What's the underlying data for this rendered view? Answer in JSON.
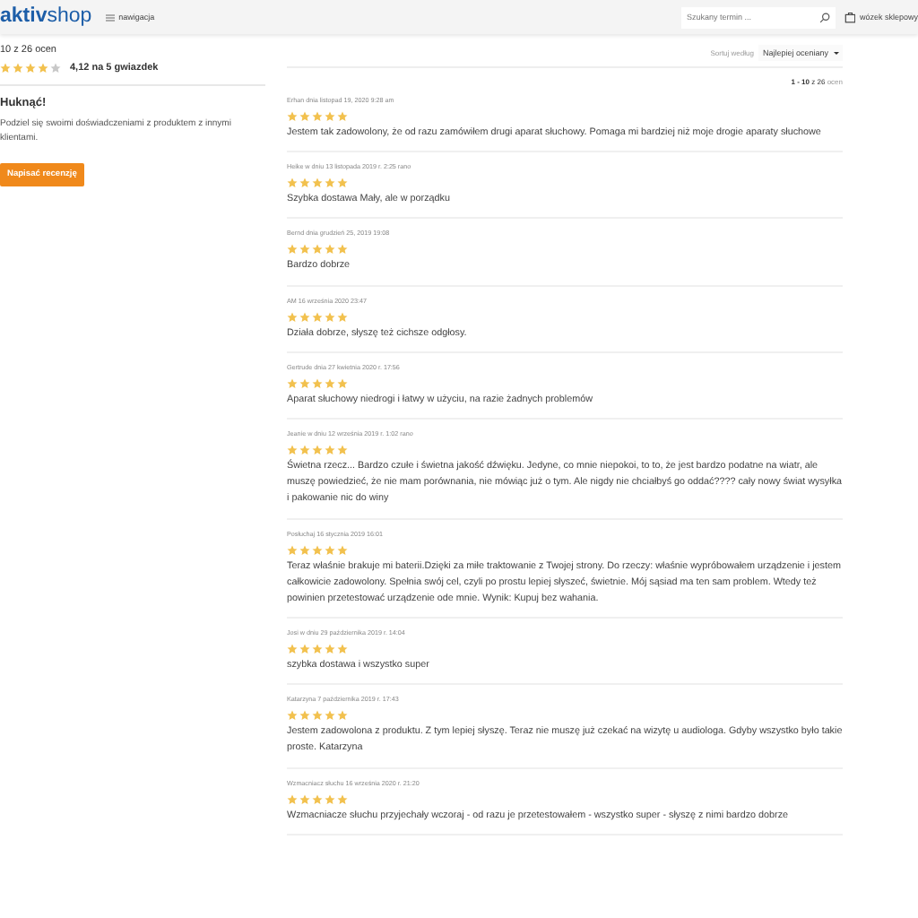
{
  "header": {
    "logo_brand": "aktiv",
    "logo_suffix": "shop",
    "nav_label": "nawigacja",
    "search": {
      "placeholder": "Szukany termin ..."
    },
    "cart_label": "wózek sklepowy"
  },
  "summary": {
    "count": "10 z 26 ocen",
    "stars": 4,
    "average": "4,12 na 5 gwiazdek"
  },
  "cta": {
    "title": "Huknąć!",
    "text": "Podziel się swoimi doświadczeniami z produktem z innymi klientami.",
    "button": "Napisać recenzję"
  },
  "sort": {
    "label": "Sortuj według",
    "value": "Najlepiej oceniany"
  },
  "pagination": {
    "range": "1 - 10",
    "of": "z 26",
    "unit": "ocen"
  },
  "reviews": [
    {
      "meta": "Erhan dnia listopad 19, 2020 9:28 am",
      "stars": 5,
      "text": "Jestem tak zadowolony, że od razu zamówiłem drugi aparat słuchowy. Pomaga mi bardziej niż moje drogie aparaty słuchowe"
    },
    {
      "meta": "Heike w dniu 13 listopada 2019 r. 2:25 rano",
      "stars": 5,
      "text": "Szybka dostawa Mały, ale w porządku"
    },
    {
      "meta": "Bernd dnia grudzień 25, 2019 19:08",
      "stars": 5,
      "text": "Bardzo dobrze"
    },
    {
      "meta": "AM 16 września 2020 23:47",
      "stars": 5,
      "text": "Działa dobrze, słyszę też cichsze odgłosy."
    },
    {
      "meta": "Gertrude dnia 27 kwietnia 2020 r. 17:56",
      "stars": 5,
      "text": "Aparat słuchowy niedrogi i łatwy w użyciu, na razie żadnych problemów"
    },
    {
      "meta": "Jeanie w dniu 12 września 2019 r. 1:02 rano",
      "stars": 5,
      "text": "Świetna rzecz... Bardzo czułe i świetna jakość dźwięku. Jedyne, co mnie niepokoi, to to, że jest bardzo podatne na wiatr, ale muszę powiedzieć, że nie mam porównania, nie mówiąc już o tym. Ale nigdy nie chciałbyś go oddać???? cały nowy świat wysyłka i pakowanie nic do winy"
    },
    {
      "meta": "Posłuchaj 16 stycznia 2019 16:01",
      "stars": 5,
      "text": "Teraz właśnie brakuje mi baterii.Dzięki za miłe traktowanie z Twojej strony. Do rzeczy: właśnie wypróbowałem urządzenie i jestem całkowicie zadowolony. Spełnia swój cel, czyli po prostu lepiej słyszeć, świetnie. Mój sąsiad ma ten sam problem. Wtedy też powinien przetestować urządzenie ode mnie. Wynik: Kupuj bez wahania."
    },
    {
      "meta": "Josi w dniu 29 października 2019 r. 14:04",
      "stars": 5,
      "text": "szybka dostawa i wszystko super"
    },
    {
      "meta": "Katarzyna 7 października 2019 r. 17:43",
      "stars": 5,
      "text": "Jestem zadowolona z produktu. Z tym lepiej słyszę. Teraz nie muszę już czekać na wizytę u audiologa. Gdyby wszystko było takie proste. Katarzyna"
    },
    {
      "meta": "Wzmacniacz słuchu 16 września 2020 r. 21:20",
      "stars": 5,
      "text": "Wzmacniacze słuchu przyjechały wczoraj - od razu je przetestowałem - wszystko super - słyszę z nimi bardzo dobrze"
    }
  ]
}
